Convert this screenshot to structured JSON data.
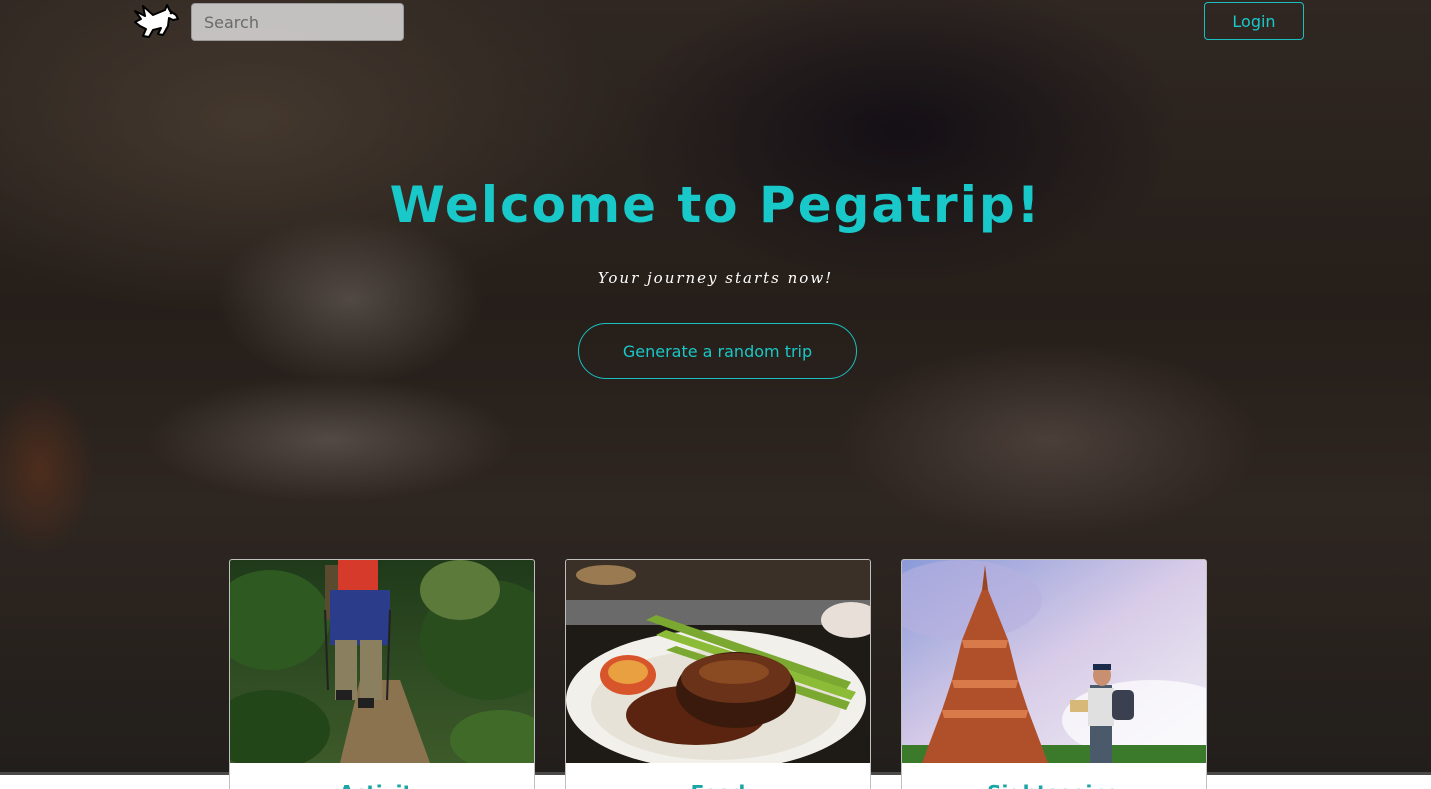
{
  "header": {
    "logo_icon": "pegasus-logo-icon",
    "search": {
      "placeholder": "Search",
      "value": ""
    },
    "login_label": "Login"
  },
  "hero": {
    "title": "Welcome to Pegatrip!",
    "subtitle": "Your journey starts now!",
    "cta_label": "Generate a random trip"
  },
  "cards": [
    {
      "title": "Activity",
      "image": "hiking-photo"
    },
    {
      "title": "Food",
      "image": "steak-dinner-photo"
    },
    {
      "title": "Sightseeing",
      "image": "temple-traveler-photo"
    }
  ],
  "colors": {
    "accent": "#19c8c8",
    "card_title": "#1aa6a6"
  }
}
